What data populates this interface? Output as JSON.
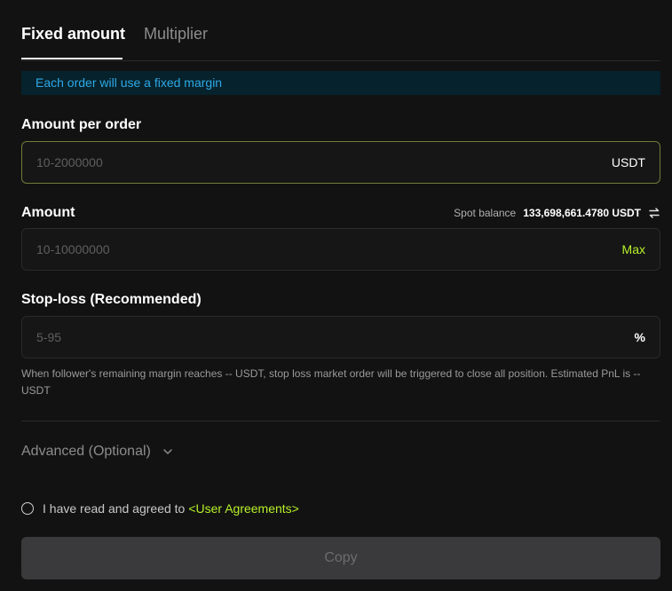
{
  "tabs": {
    "fixed_amount": "Fixed amount",
    "multiplier": "Multiplier"
  },
  "banner": {
    "text": "Each order will use a fixed margin"
  },
  "amount_per_order": {
    "label": "Amount per order",
    "placeholder": "10-2000000",
    "unit": "USDT"
  },
  "amount": {
    "label": "Amount",
    "placeholder": "10-10000000",
    "max_label": "Max",
    "spot_balance_label": "Spot balance",
    "spot_balance_value": "133,698,661.4780 USDT",
    "swap_icon": "swap-arrows-icon"
  },
  "stop_loss": {
    "label": "Stop-loss (Recommended)",
    "placeholder": "5-95",
    "unit": "%",
    "note": "When follower's remaining margin reaches -- USDT, stop loss market order will be triggered to close all position. Estimated PnL is -- USDT"
  },
  "advanced": {
    "label": "Advanced (Optional)",
    "icon": "chevron-down-icon"
  },
  "agreement": {
    "text": "I have read and agreed to",
    "link": "<User Agreements>"
  },
  "submit": {
    "label": "Copy"
  },
  "colors": {
    "accent": "#b8f22a",
    "info": "#2ea9e6",
    "background": "#121212"
  }
}
